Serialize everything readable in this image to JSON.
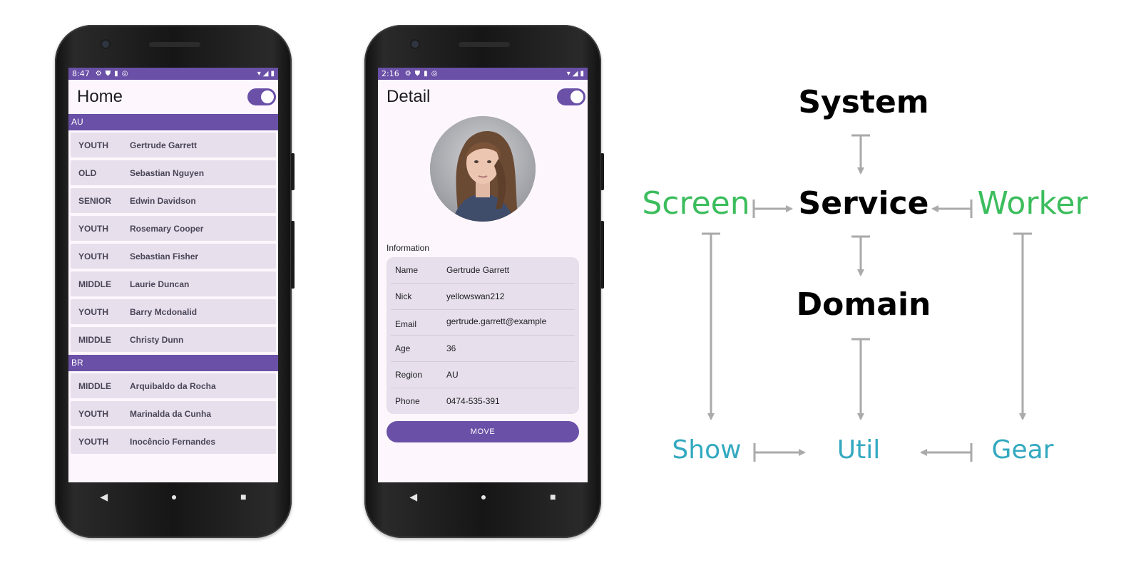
{
  "colors": {
    "primary": "#6a50a7",
    "row_bg": "#e7e0ec",
    "diagram_black": "#000000",
    "diagram_green": "#3cbd5d",
    "diagram_teal": "#33a9c0",
    "arrow": "#aaaaaa"
  },
  "home_screen": {
    "status_time": "8:47",
    "title": "Home",
    "theme_toggle": "on",
    "groups": [
      {
        "header": "AU",
        "rows": [
          {
            "age": "YOUTH",
            "name": "Gertrude Garrett"
          },
          {
            "age": "OLD",
            "name": "Sebastian Nguyen"
          },
          {
            "age": "SENIOR",
            "name": "Edwin Davidson"
          },
          {
            "age": "YOUTH",
            "name": "Rosemary Cooper"
          },
          {
            "age": "YOUTH",
            "name": "Sebastian Fisher"
          },
          {
            "age": "MIDDLE",
            "name": "Laurie Duncan"
          },
          {
            "age": "YOUTH",
            "name": "Barry Mcdonalid"
          },
          {
            "age": "MIDDLE",
            "name": "Christy Dunn"
          }
        ]
      },
      {
        "header": "BR",
        "rows": [
          {
            "age": "MIDDLE",
            "name": "Arquibaldo da Rocha"
          },
          {
            "age": "YOUTH",
            "name": "Marinalda da Cunha"
          },
          {
            "age": "YOUTH",
            "name": "Inocêncio Fernandes"
          }
        ]
      }
    ]
  },
  "detail_screen": {
    "status_time": "2:16",
    "title": "Detail",
    "theme_toggle": "on",
    "info_label": "Information",
    "fields": [
      {
        "key": "Name",
        "value": "Gertrude Garrett"
      },
      {
        "key": "Nick",
        "value": "yellowswan212"
      },
      {
        "key": "Email",
        "value": "gertrude.garrett@example"
      },
      {
        "key": "Age",
        "value": "36"
      },
      {
        "key": "Region",
        "value": "AU"
      },
      {
        "key": "Phone",
        "value": "0474-535-391"
      }
    ],
    "move_button": "MOVE"
  },
  "diagram": {
    "system": "System",
    "service": "Service",
    "domain": "Domain",
    "screen": "Screen",
    "worker": "Worker",
    "show": "Show",
    "util": "Util",
    "gear": "Gear"
  }
}
